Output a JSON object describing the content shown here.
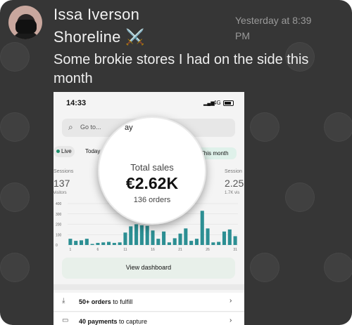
{
  "message": {
    "sender": "Issa Iverson",
    "group": "Shoreline ⚔️",
    "timestamp": "Yesterday at 8:39 PM",
    "text": "Some brokie stores I had on the side this month"
  },
  "screenshot": {
    "status": {
      "time": "14:33",
      "network": "4G"
    },
    "search": {
      "placeholder": "Go to..."
    },
    "filters": {
      "live": "Live",
      "today": "Today",
      "month": "This month"
    },
    "sessions": {
      "label_left": "Sessions",
      "value_left": "137",
      "sub_left": "visitors",
      "label_right": "Session",
      "value_right": "2.25",
      "sub_right": "1.7K vis"
    },
    "total_sales": {
      "label": "Total sales",
      "value": "€2.62K",
      "orders": "136 orders",
      "peek": "ay"
    },
    "view_dashboard": "View dashboard",
    "tasks": [
      {
        "bold": "50+ orders",
        "rest": " to fulfill"
      },
      {
        "bold": "40 payments",
        "rest": " to capture"
      }
    ]
  },
  "chart_data": {
    "type": "bar",
    "x_ticks": [
      "1",
      "6",
      "11",
      "16",
      "21",
      "26",
      "31"
    ],
    "y_ticks": [
      "400",
      "300",
      "200",
      "100",
      "0"
    ],
    "ylim": [
      0,
      400
    ],
    "categories": [
      "1",
      "2",
      "3",
      "4",
      "5",
      "6",
      "7",
      "8",
      "9",
      "10",
      "11",
      "12",
      "13",
      "14",
      "15",
      "16",
      "17",
      "18",
      "19",
      "20",
      "21",
      "22",
      "23",
      "24",
      "25",
      "26",
      "27",
      "28",
      "29",
      "30",
      "31"
    ],
    "values": [
      60,
      40,
      45,
      60,
      10,
      20,
      25,
      30,
      20,
      25,
      120,
      180,
      200,
      190,
      185,
      140,
      60,
      130,
      25,
      65,
      110,
      160,
      40,
      60,
      330,
      160,
      25,
      30,
      130,
      150,
      85
    ],
    "colors": {
      "bar": "#2c8f93",
      "axis": "#666666"
    }
  }
}
